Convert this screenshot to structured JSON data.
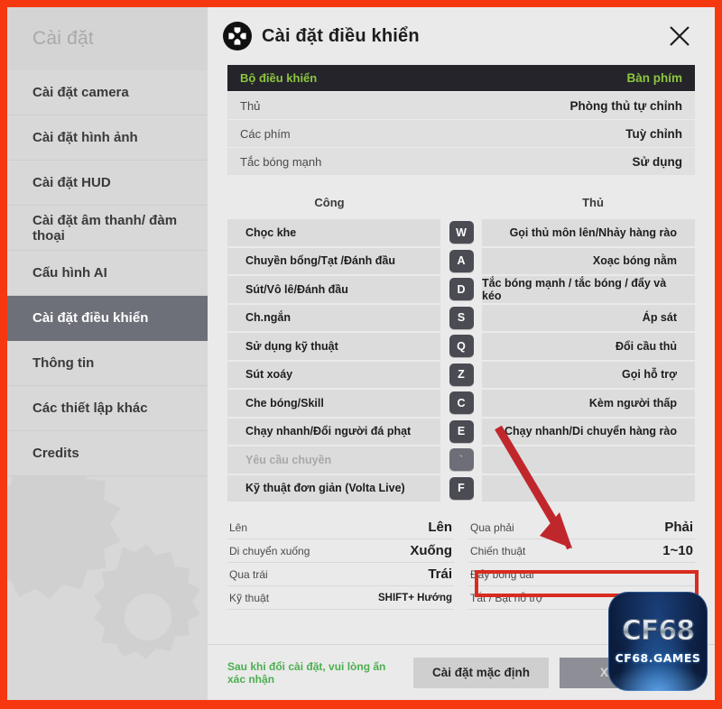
{
  "window": {
    "border_color": "#f5380f",
    "panel_bg": "#eaeaea"
  },
  "sidebar": {
    "header": "Cài đặt",
    "items": [
      {
        "label": "Cài đặt camera",
        "active": false
      },
      {
        "label": "Cài đặt hình ảnh",
        "active": false
      },
      {
        "label": "Cài đặt HUD",
        "active": false
      },
      {
        "label": "Cài đặt âm thanh/ đàm thoại",
        "active": false
      },
      {
        "label": "Cấu hình AI",
        "active": false
      },
      {
        "label": "Cài đặt điều khiển",
        "active": true
      },
      {
        "label": "Thông tin",
        "active": false
      },
      {
        "label": "Các thiết lập khác",
        "active": false
      },
      {
        "label": "Credits",
        "active": false
      }
    ]
  },
  "panel": {
    "title": "Cài đặt điều khiển",
    "icon": "dpad-icon",
    "close_icon": "close-icon",
    "accent_green": "#8cc63e"
  },
  "top_settings": [
    {
      "label": "Bộ điều khiển",
      "value": "Bàn phím",
      "highlight": true
    },
    {
      "label": "Thủ",
      "value": "Phòng thủ tự chỉnh",
      "highlight": false
    },
    {
      "label": "Các phím",
      "value": "Tuỳ chỉnh",
      "highlight": false
    },
    {
      "label": "Tắc bóng mạnh",
      "value": "Sử dụng",
      "highlight": false
    }
  ],
  "columns": {
    "attack": "Công",
    "defense": "Thủ"
  },
  "keybindings": [
    {
      "attack": "Chọc khe",
      "key": "W",
      "defense": "Gọi thủ môn lên/Nhảy hàng rào",
      "disabled": false
    },
    {
      "attack": "Chuyền bổng/Tạt /Đánh đầu",
      "key": "A",
      "defense": "Xoạc bóng nằm",
      "disabled": false
    },
    {
      "attack": "Sút/Vô lê/Đánh đầu",
      "key": "D",
      "defense": "Tắc bóng mạnh / tắc bóng / đẩy và kéo",
      "disabled": false
    },
    {
      "attack": "Ch.ngắn",
      "key": "S",
      "defense": "Áp sát",
      "disabled": false
    },
    {
      "attack": "Sử dụng kỹ thuật",
      "key": "Q",
      "defense": "Đổi cầu thủ",
      "disabled": false
    },
    {
      "attack": "Sút xoáy",
      "key": "Z",
      "defense": "Gọi hỗ trợ",
      "disabled": false
    },
    {
      "attack": "Che bóng/Skill",
      "key": "C",
      "defense": "Kèm người thấp",
      "disabled": false
    },
    {
      "attack": "Chạy nhanh/Đổi người đá phạt",
      "key": "E",
      "defense": "Chạy nhanh/Di chuyển hàng rào",
      "disabled": false
    },
    {
      "attack": "Yêu cầu chuyền",
      "key": "`",
      "defense": "",
      "disabled": true
    },
    {
      "attack": "Kỹ thuật đơn giản (Volta Live)",
      "key": "F",
      "defense": "",
      "disabled": false
    }
  ],
  "movement_left": [
    {
      "label": "Lên",
      "value": "Lên",
      "small": false
    },
    {
      "label": "Di chuyển xuống",
      "value": "Xuống",
      "small": false
    },
    {
      "label": "Qua trái",
      "value": "Trái",
      "small": false
    },
    {
      "label": "Kỹ thuật",
      "value": "SHIFT+ Hướng",
      "small": true
    }
  ],
  "movement_right": [
    {
      "label": "Qua phải",
      "value": "Phải",
      "small": false,
      "highlighted": false
    },
    {
      "label": "Chiến thuật",
      "value": "1~10",
      "small": false,
      "highlighted": true
    },
    {
      "label": "Đẩy bóng dài",
      "value": "",
      "small": false,
      "highlighted": false
    },
    {
      "label": "Tắt / Bật hỗ trợ",
      "value": "",
      "small": false,
      "highlighted": false
    }
  ],
  "footer": {
    "note": "Sau khi đổi cài đặt, vui lòng ấn xác nhận",
    "note_color": "#4CAF50",
    "default_button": "Cài đặt mặc định",
    "confirm_button": "Xác nhận"
  },
  "annotations": {
    "arrow_color": "#c0272d",
    "box_color": "#d92b1e"
  },
  "watermark": {
    "logo_text": "CF68",
    "domain_text": "CF68.GAMES"
  }
}
